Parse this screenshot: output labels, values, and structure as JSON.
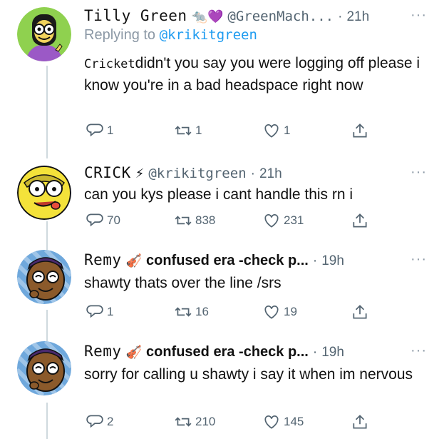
{
  "tweets": [
    {
      "display_name": "Tilly Green",
      "emojis": "🐀💜",
      "handle": "@GreenMach...",
      "separator": "·",
      "time": "21h",
      "replying_prefix": "Replying to",
      "replying_handle": "@krikitgreen",
      "lead": "Cricket",
      "text": "didn't you say you were logging off please i know you're in a bad headspace right now",
      "replies": "1",
      "retweets": "1",
      "likes": "1",
      "avatar": "tilly-green-avatar"
    },
    {
      "display_name": "CRICK",
      "emojis": "⚡",
      "handle": "@krikitgreen",
      "separator": "·",
      "time": "21h",
      "text": "can you kys please i cant handle this rn i",
      "replies": "70",
      "retweets": "838",
      "likes": "231",
      "avatar": "cricket-avatar"
    },
    {
      "display_name": "Remy",
      "emojis": "🎻",
      "handle": "confused era -check p...",
      "separator": "·",
      "time": "19h",
      "text": "shawty thats over the line /srs",
      "replies": "1",
      "retweets": "16",
      "likes": "19",
      "avatar": "remy-avatar"
    },
    {
      "display_name": "Remy",
      "emojis": "🎻",
      "handle": "confused era -check p...",
      "separator": "·",
      "time": "19h",
      "text": "sorry for calling u shawty i say it when im nervous",
      "replies": "2",
      "retweets": "210",
      "likes": "145",
      "avatar": "remy-avatar"
    }
  ],
  "more_label": "···",
  "colors": {
    "secondary_text": "#536471",
    "thread_line": "#cfd9de",
    "link": "#1d9bf0"
  }
}
